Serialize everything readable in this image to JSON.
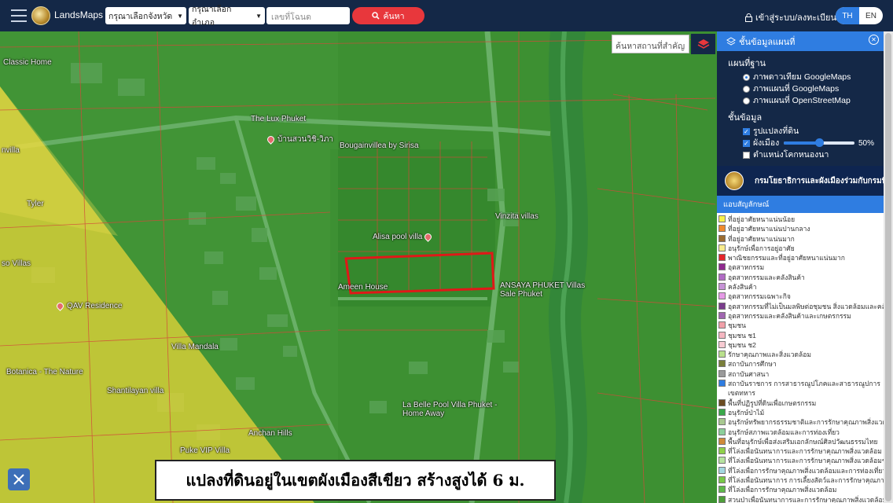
{
  "header": {
    "brand": "LandsMaps",
    "province_select": "กรุณาเลือกจังหวัด",
    "amphoe_select": "กรุณาเลือกอำเภอ",
    "deed_placeholder": "เลขที่โฉนด",
    "search_label": "ค้นหา",
    "login_label": "เข้าสู่ระบบ/ลงทะเบียน",
    "lang_th": "TH",
    "lang_en": "EN"
  },
  "map": {
    "place_search_placeholder": "ค้นหาสถานที่สำคัญ",
    "pois": [
      {
        "label": "Classic Home"
      },
      {
        "label": "The Lux Phuket"
      },
      {
        "label": "บ้านสวนวิชิ-วิภา"
      },
      {
        "label": "Bougainvillea by Sirisa"
      },
      {
        "label": "Vinzita villas"
      },
      {
        "label": "Alisa pool villa"
      },
      {
        "label": "Ameen House"
      },
      {
        "label": "ANSAYA PHUKET Villas Sale Phuket"
      },
      {
        "label": "QAV Residence"
      },
      {
        "label": "Villa Mandala"
      },
      {
        "label": "Botanica - The Nature"
      },
      {
        "label": "Shantilayan villa"
      },
      {
        "label": "La Belle Pool Villa Phuket - Home Away"
      },
      {
        "label": "Anchan Hills"
      },
      {
        "label": "Puke VIP Villa"
      },
      {
        "label": "Tyler"
      },
      {
        "label": "nvilla"
      },
      {
        "label": "so Villas"
      }
    ],
    "caption": "แปลงที่ดินอยู่ในเขตผังเมืองสีเขียว สร้างสูงได้ 6 ม."
  },
  "panel": {
    "title": "ชั้นข้อมูลแผนที่",
    "basemap_title": "แผนที่ฐาน",
    "basemaps": [
      {
        "label": "ภาพดาวเทียม GoogleMaps",
        "selected": true
      },
      {
        "label": "ภาพแผนที่ GoogleMaps",
        "selected": false
      },
      {
        "label": "ภาพแผนที่ OpenStreetMap",
        "selected": false
      }
    ],
    "layers_title": "ชั้นข้อมูล",
    "layers": [
      {
        "label": "รูปแปลงที่ดิน",
        "checked": true
      },
      {
        "label": "ผังเมือง",
        "checked": true
      },
      {
        "label": "ตำแหน่งโคกหนองนา",
        "checked": false
      }
    ],
    "opacity_percent": 50,
    "opacity_label": "50%",
    "banner_text": "กรมโยธาธิการและผังเมืองร่วมกับกรมที่ดิน",
    "legend_title": "แอบสัญลักษณ์",
    "legend": [
      {
        "label": "ที่อยู่อาศัยหนาแน่นน้อย",
        "color": "#f7f14a"
      },
      {
        "label": "ที่อยู่อาศัยหนาแน่นปานกลาง",
        "color": "#f08a2c"
      },
      {
        "label": "ที่อยู่อาศัยหนาแน่นมาก",
        "color": "#9b6b2f"
      },
      {
        "label": "อนุรักษ์เพื่อการอยู่อาศัย",
        "color": "#f8ec8c"
      },
      {
        "label": "พาณิชยกรรมและที่อยู่อาศัยหนาแน่นมาก",
        "color": "#e4262b"
      },
      {
        "label": "อุตสาหกรรม",
        "color": "#8e2a8e"
      },
      {
        "label": "อุตสาหกรรมและคลังสินค้า",
        "color": "#b06bc4"
      },
      {
        "label": "คลังสินค้า",
        "color": "#c693d6"
      },
      {
        "label": "อุตสาหกรรมเฉพาะกิจ",
        "color": "#e59ae6"
      },
      {
        "label": "อุตสาหกรรมที่ไม่เป็นมลพิษต่อชุมชน สิ่งแวดล้อมและคลังสินค้า",
        "color": "#7a3d8c"
      },
      {
        "label": "อุตสาหกรรมและคลังสินค้าและเกษตรกรรม",
        "color": "#a066b0"
      },
      {
        "label": "ชุมชน",
        "color": "#f0a0a8"
      },
      {
        "label": "ชุมชน ช1",
        "color": "#f4b6c0"
      },
      {
        "label": "ชุมชน ช2",
        "color": "#f7cbd2"
      },
      {
        "label": "รักษาคุณภาพและสิ่งแวดล้อม",
        "color": "#b9e08c"
      },
      {
        "label": "สถาบันการศึกษา",
        "color": "#7a7f3a"
      },
      {
        "label": "สถาบันศาสนา",
        "color": "#9a9a9a"
      },
      {
        "label": "สถาบันราชการ การสาธารณูปโภคและสาธารณูปการ",
        "color": "#2f7de1"
      },
      {
        "label": "เขตทหาร",
        "color": ""
      },
      {
        "label": "พื้นที่ปฏิรูปที่ดินเพื่อเกษตรกรรม",
        "color": "#6a4a20"
      },
      {
        "label": "อนุรักษ์ป่าไม้",
        "color": "#3aa84a"
      },
      {
        "label": "อนุรักษ์ทรัพยากรธรรมชาติและการรักษาคุณภาพสิ่งแวดล้อม",
        "color": "#a8c890"
      },
      {
        "label": "อนุรักษ์สภาพแวดล้อมและการท่องเที่ยว",
        "color": "#8ccf9a"
      },
      {
        "label": "พื้นที่อนุรักษ์เพื่อส่งเสริมเอกลักษณ์ศิลปวัฒนธรรมไทย",
        "color": "#d08a3a"
      },
      {
        "label": "ที่โล่งเพื่อนันทนาการและการรักษาคุณภาพสิ่งแวดล้อม",
        "color": "#8fd14a"
      },
      {
        "label": "ที่โล่งเพื่อนันทนาการและการรักษาคุณภาพสิ่งแวดล้อมชายฝั่ง",
        "color": "#b6e3a0"
      },
      {
        "label": "ที่โล่งเพื่อการรักษาคุณภาพสิ่งแวดล้อมและการท่องเที่ยวและการรักษา",
        "color": "#a3d7e0"
      },
      {
        "label": "ที่โล่งเพื่อนันทนาการ การเลี้ยงสัตว์และการรักษาคุณภาพสิ่งแวดล้อม",
        "color": "#78c848"
      },
      {
        "label": "ที่โล่งเพื่อการรักษาคุณภาพสิ่งแวดล้อม",
        "color": "#5fb84a"
      },
      {
        "label": "สวนป่าเพื่อนันทนาการและการรักษาคุณภาพสิ่งแวดล้อม",
        "color": "#4e9e3a"
      },
      {
        "label": "สวนป่าเพื่อรักษาสภาพป่าชายเลน",
        "color": "#3f8a36"
      }
    ]
  }
}
